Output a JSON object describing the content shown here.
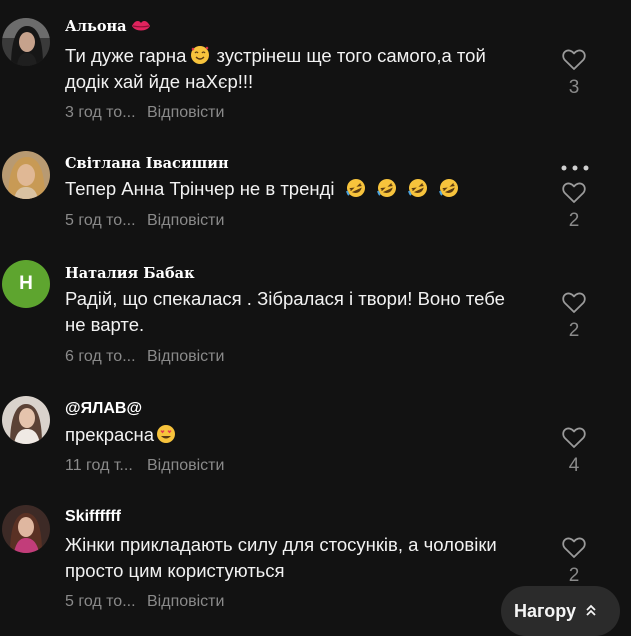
{
  "comments": [
    {
      "user": "Альона",
      "user_emoji": "lips-emoji",
      "text_line1": "Ти дуже гарна",
      "text_line1_emoji": "smiling-face-with-hearts-emoji",
      "text_line1_rest": "зустрінеш ще того самого,а той",
      "text_line2": "додік хай йде наХєр!!!",
      "time": "3 год то...",
      "reply": "Відповісти",
      "likes": "3"
    },
    {
      "user": "Світлана Івасишин",
      "text": "Тепер Анна Трінчер не в тренді",
      "text_emoji": "rolling-on-floor-laughing-emoji",
      "text_emoji_count": 4,
      "time": "5 год то...",
      "reply": "Відповісти",
      "likes": "2"
    },
    {
      "user": "Наталия Бабак",
      "avatar_letter": "Н",
      "text": "Радій, що спекалася . Зібралася і твори! Воно тебе не варте.",
      "time": "6 год то...",
      "reply": "Відповісти",
      "likes": "2"
    },
    {
      "user": "@ЯЛАВ@",
      "text": "прекрасна",
      "text_emoji": "smiling-face-with-heart-eyes-emoji",
      "time": "11 год т...",
      "reply": "Відповісти",
      "likes": "4"
    },
    {
      "user": "Skiffffff",
      "text": "Жінки прикладають силу для стосунків, а чоловіки просто цим користуються",
      "time": "5 год то...",
      "reply": "Відповісти",
      "likes": "2"
    }
  ],
  "icons": {
    "like": "heart-outline-icon",
    "more": "more-horizontal-icon",
    "back_to_top": "double-chevron-up-icon"
  },
  "back_to_top": {
    "label": "Нагору",
    "icon_glyph": "⌃"
  },
  "colors": {
    "background": "#121212",
    "text": "#f2f2f2",
    "muted": "#8a8a8a",
    "letter_avatar": "#5ea52f",
    "pill": "#2b2b2b"
  }
}
